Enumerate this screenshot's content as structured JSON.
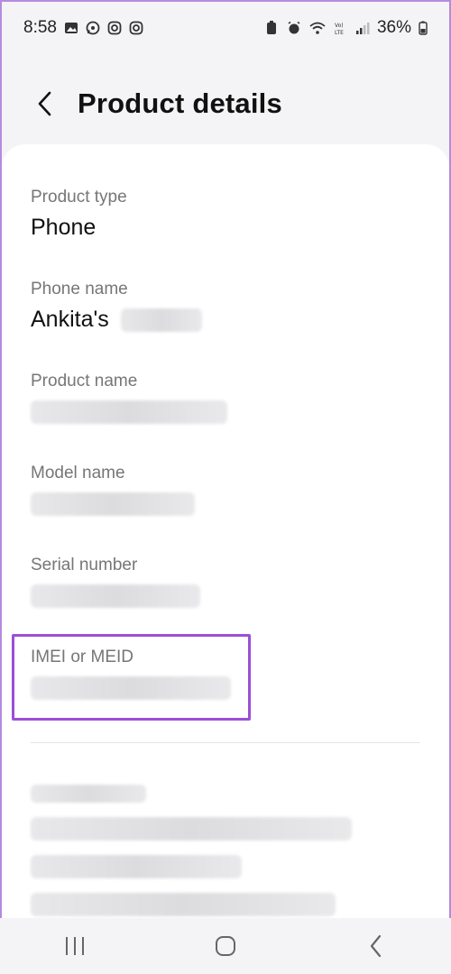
{
  "status_bar": {
    "time": "8:58",
    "battery": "36%"
  },
  "header": {
    "title": "Product details"
  },
  "fields": {
    "product_type": {
      "label": "Product type",
      "value": "Phone"
    },
    "phone_name": {
      "label": "Phone name",
      "value": "Ankita's"
    },
    "product_name": {
      "label": "Product name"
    },
    "model_name": {
      "label": "Model name"
    },
    "serial_number": {
      "label": "Serial number"
    },
    "imei": {
      "label": "IMEI or MEID"
    }
  },
  "colors": {
    "highlight": "#9b4fd8",
    "frame": "#b48be0"
  }
}
